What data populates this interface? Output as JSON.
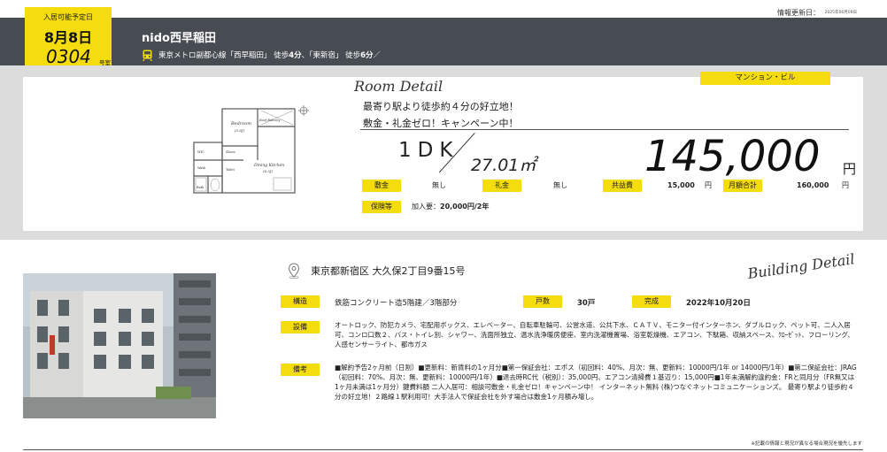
{
  "header": {
    "update_label": "情報更新日：",
    "update_value": "2025年06月09日",
    "building_name": "nido西早稲田",
    "station_prefix": "東京メトロ副都心線「西早稲田」 徒歩",
    "station_walk1": "4分",
    "station_mid": "、「東新宿」 徒歩",
    "station_walk2": "6分",
    "station_suffix": "／"
  },
  "movein_tag": {
    "label": "入居可能予定日",
    "date": "8月8日",
    "room_number": "0304",
    "room_suffix": "号室"
  },
  "room_detail": {
    "title": "Room Detail",
    "property_type": "マンション・ビル",
    "catch_line1": "最寄り駅より徒歩約４分の好立地！",
    "catch_line2": "敷金・礼金ゼロ！キャンペーン中！",
    "layout": "1DK",
    "area": "27.01㎡",
    "rent": "145,000",
    "rent_unit": "円",
    "fees": {
      "deposit_label": "敷金",
      "deposit_value": "無し",
      "key_money_label": "礼金",
      "key_money_value": "無し",
      "common_fee_label": "共益費",
      "common_fee_value": "15,000",
      "common_fee_unit": "円",
      "monthly_total_label": "月額合計",
      "monthly_total_value": "160,000",
      "monthly_total_unit": "円"
    },
    "insurance_label": "保険等",
    "insurance_prefix": "加入要：",
    "insurance_value": "20,000円/2年"
  },
  "floor_plan": {
    "bedroom": "Bedroom",
    "bedroom_size": "(3.6J)",
    "dining": "Dining Kitchen",
    "dining_size": "(6.5J)",
    "roof_balcony": "Roof Balcony",
    "wash": "Wash",
    "toilet": "Toilet",
    "bath": "Bath",
    "wic": "WIC",
    "shoes": "Shoes"
  },
  "building_detail": {
    "title": "Building Detail",
    "address": "東京都新宿区 大久保2丁目9番15号",
    "structure_label": "構造",
    "structure_value": "鉄筋コンクリート造5階建／3階部分",
    "units_label": "戸数",
    "units_value": "30戸",
    "completed_label": "完成",
    "completed_value": "2022年10月20日",
    "facilities_label": "設備",
    "facilities_value": "オートロック、防犯カメラ、宅配用ボックス、エレベーター、自転車駐輪可、公営水道、公共下水、ＣＡＴＶ、モニター付インターホン、ダブルロック、ペット可、二人入居可、コンロ口数２、バス・トイレ別、シャワー、洗面所独立、温水洗浄暖房便座、室内洗濯機置場、浴室乾燥機、エアコン、下駄箱、収納スペース、ｸﾛｰｾﾞｯﾄ、フローリング、人感センサーライト、都市ガス",
    "remarks_label": "備考",
    "remarks_value": "■解約予告2ヶ月前（日割）■更新料：新賃料の1ヶ月分■第一保証会社：エポス（初回料：40%、月次：無、更新料：10000円/1年 or 14000円/1年）■第二保証会社：JRAG（初回料：70%、月次：無、更新料：10000円/1年）■退去時RC代（税別）：35,000円、エアコン清掃費１基辺り：15,000円■1年未満解約違約金：FRと同月分（FR無又は1ヶ月未満は1ヶ月分）鍵費料額 二人入居可：相談可敷金・礼金ゼロ！キャンペーン中！ インターネット無料 (株)つなぐネットコミュニケーションズ。 最寄り駅より徒歩約４分の好立地！２路線１駅利用可！大手法人で保証会社を外す場合は敷金1ヶ月積み増し。"
  },
  "footer": {
    "notice": "※記載の情報と現況が異なる場合現況を優先します"
  },
  "colors": {
    "accent_yellow": "#f5dc0f",
    "header_dark": "#474c53",
    "band_gray": "#dcdcdc"
  },
  "icons": [
    "train-icon",
    "location-pin-icon",
    "compass-icon"
  ]
}
